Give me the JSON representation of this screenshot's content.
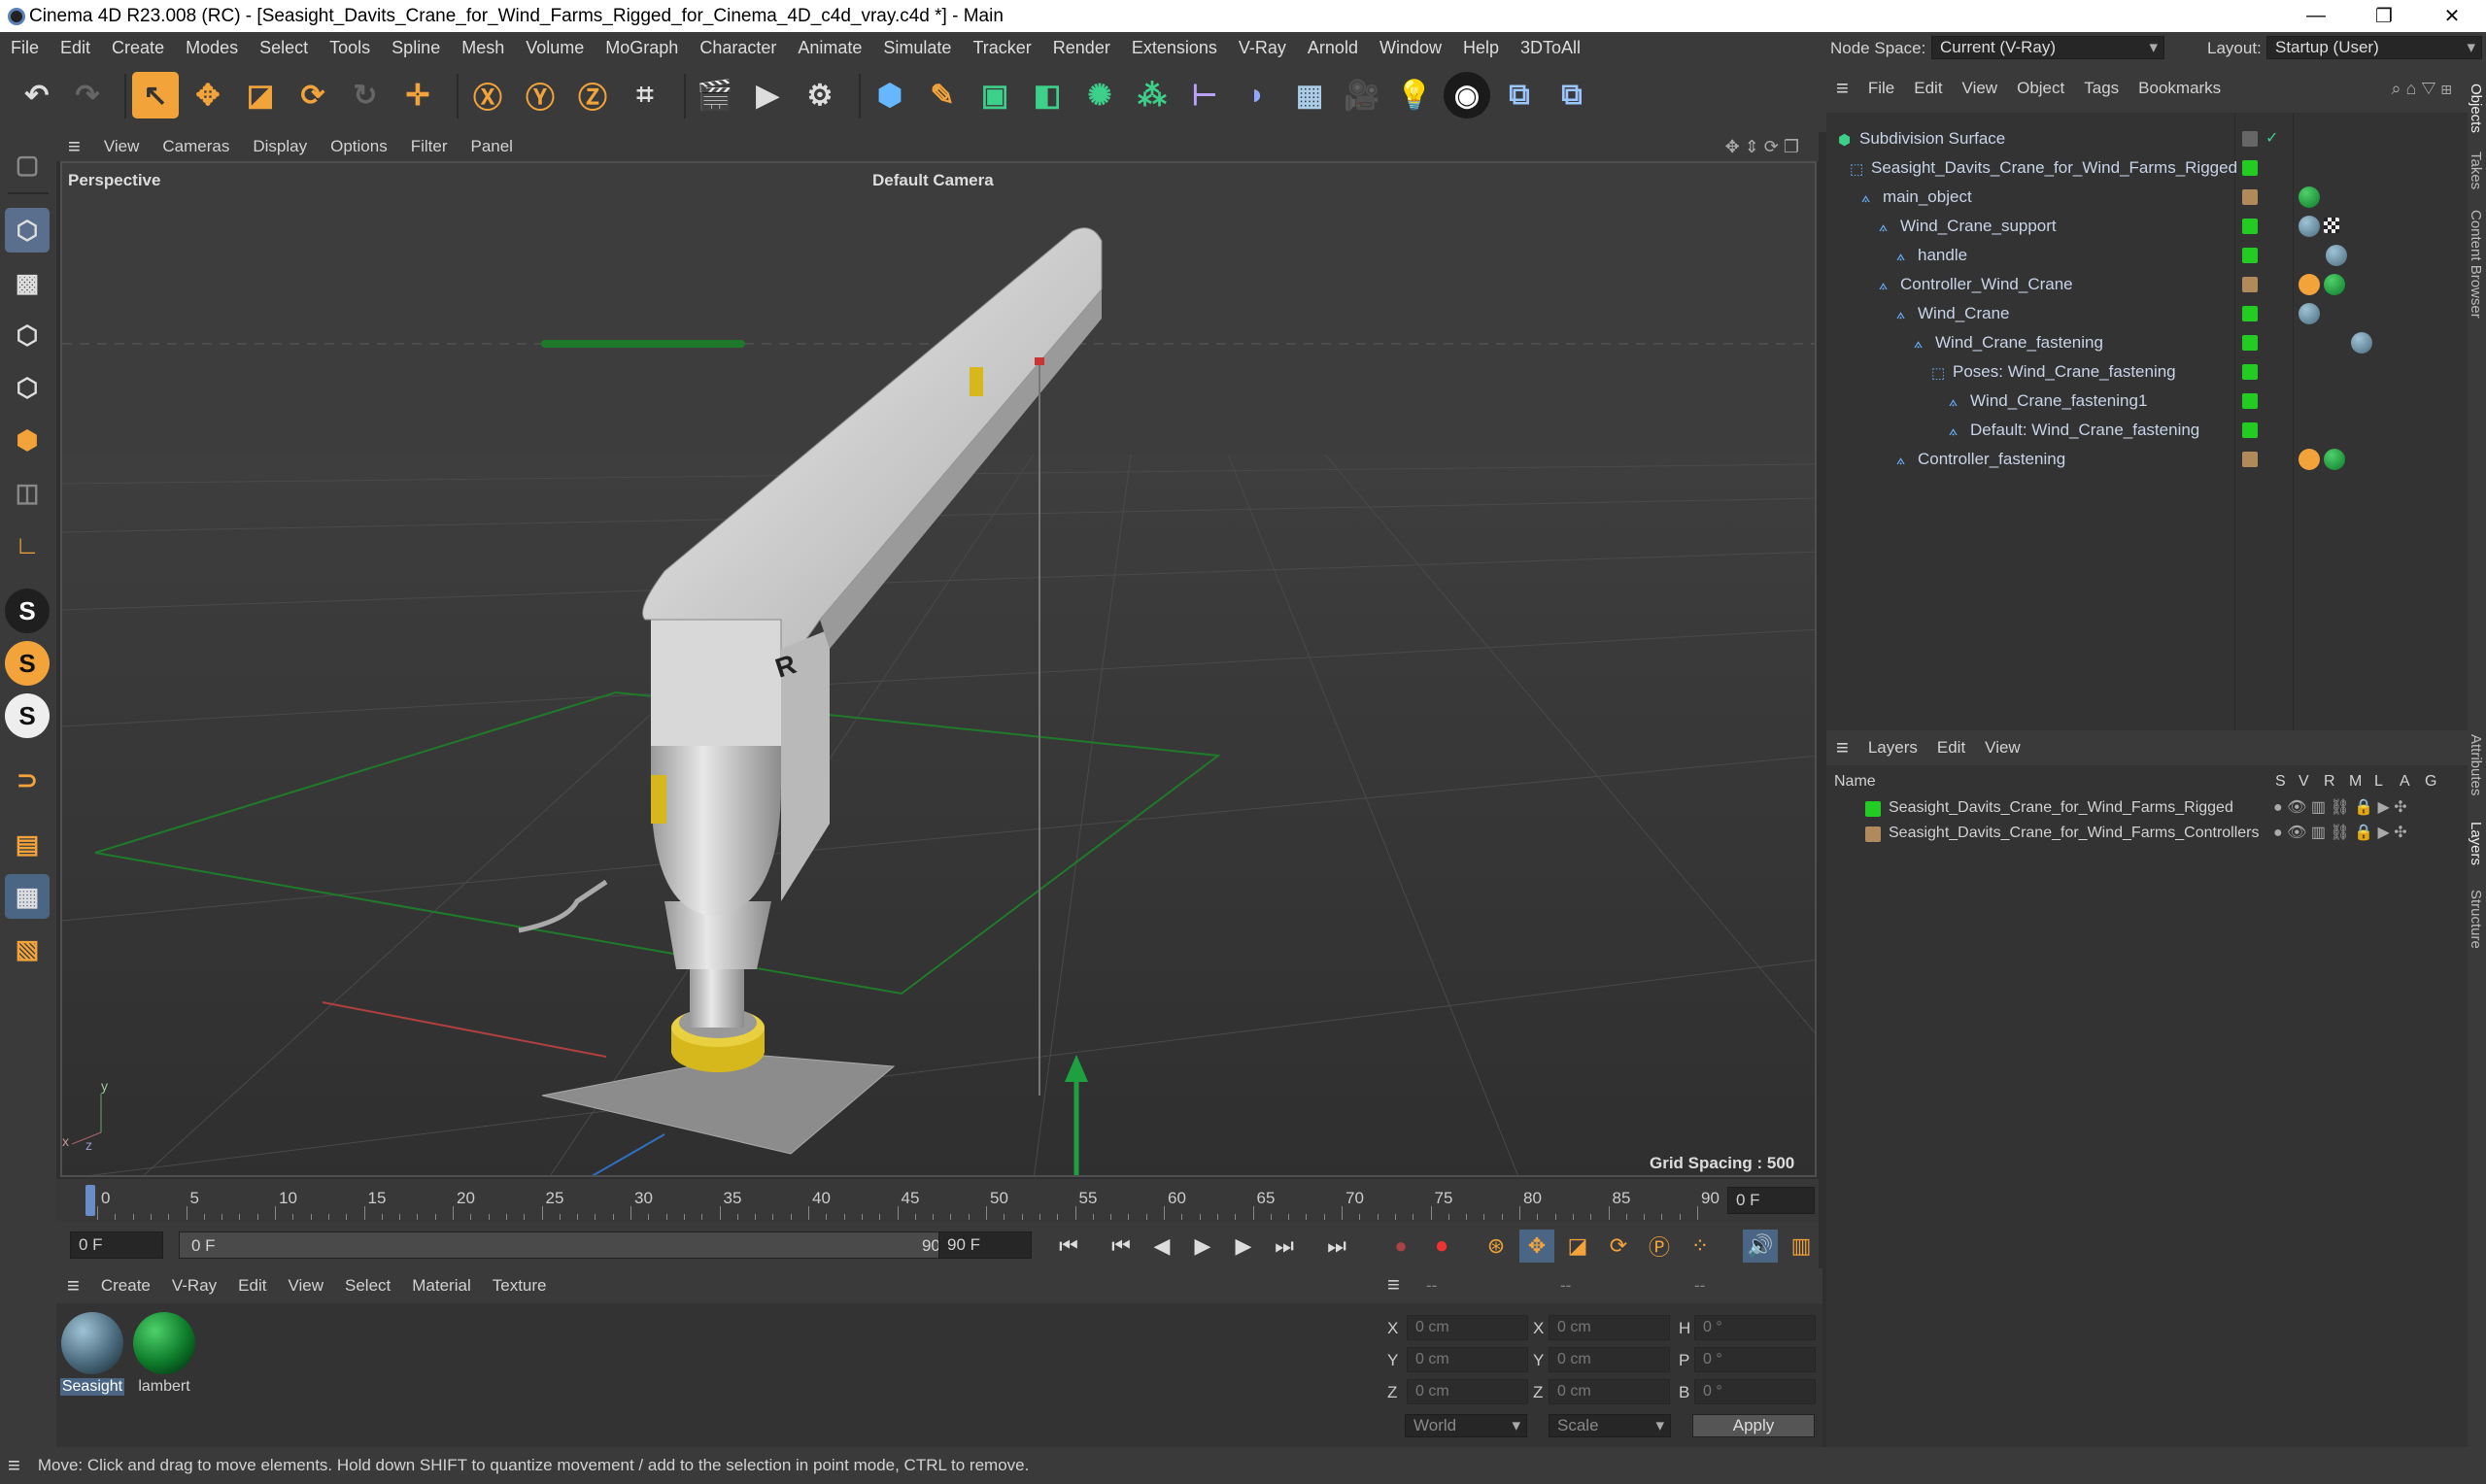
{
  "window": {
    "title": "Cinema 4D R23.008 (RC) - [Seasight_Davits_Crane_for_Wind_Farms_Rigged_for_Cinema_4D_c4d_vray.c4d *] - Main"
  },
  "menu": [
    "File",
    "Edit",
    "Create",
    "Modes",
    "Select",
    "Tools",
    "Spline",
    "Mesh",
    "Volume",
    "MoGraph",
    "Character",
    "Animate",
    "Simulate",
    "Tracker",
    "Render",
    "Extensions",
    "V-Ray",
    "Arnold",
    "Window",
    "Help",
    "3DToAll"
  ],
  "nodespace": {
    "label": "Node Space:",
    "value": "Current (V-Ray)",
    "layout_label": "Layout:",
    "layout_value": "Startup (User)"
  },
  "viewport": {
    "menu": [
      "View",
      "Cameras",
      "Display",
      "Options",
      "Filter",
      "Panel"
    ],
    "projection": "Perspective",
    "camera": "Default Camera",
    "grid_spacing": "Grid Spacing : 500 cm"
  },
  "timeline": {
    "ticks": [
      "0",
      "5",
      "10",
      "15",
      "20",
      "25",
      "30",
      "35",
      "40",
      "45",
      "50",
      "55",
      "60",
      "65",
      "70",
      "75",
      "80",
      "85",
      "90"
    ],
    "current_frame": "0 F",
    "start": "0 F",
    "range_start": "0 F",
    "range_end": "90 F",
    "end": "90 F"
  },
  "materials": {
    "menu": [
      "Create",
      "V-Ray",
      "Edit",
      "View",
      "Select",
      "Material",
      "Texture"
    ],
    "items": [
      {
        "name": "Seasight",
        "color": "#4a6b7d"
      },
      {
        "name": "lambert",
        "color": "#0d7a2a"
      }
    ]
  },
  "coords": {
    "header": [
      "--",
      "--",
      "--"
    ],
    "rows": [
      {
        "a": "X",
        "av": "0 cm",
        "b": "X",
        "bv": "0 cm",
        "c": "H",
        "cv": "0 °"
      },
      {
        "a": "Y",
        "av": "0 cm",
        "b": "Y",
        "bv": "0 cm",
        "c": "P",
        "cv": "0 °"
      },
      {
        "a": "Z",
        "av": "0 cm",
        "b": "Z",
        "bv": "0 cm",
        "c": "B",
        "cv": "0 °"
      }
    ],
    "mode": "World",
    "scale": "Scale",
    "apply": "Apply"
  },
  "objects": {
    "menu": [
      "File",
      "Edit",
      "View",
      "Object",
      "Tags",
      "Bookmarks"
    ],
    "tree": [
      {
        "name": "Subdivision Surface",
        "color": "#888888"
      },
      {
        "name": "Seasight_Davits_Crane_for_Wind_Farms_Rigged",
        "color": "#22cc22"
      },
      {
        "name": "main_object",
        "color": "#b08a5a"
      },
      {
        "name": "Wind_Crane_support",
        "color": "#22cc22"
      },
      {
        "name": "handle",
        "color": "#22cc22"
      },
      {
        "name": "Controller_Wind_Crane",
        "color": "#b08a5a"
      },
      {
        "name": "Wind_Crane",
        "color": "#22cc22"
      },
      {
        "name": "Wind_Crane_fastening",
        "color": "#22cc22"
      },
      {
        "name": "Poses: Wind_Crane_fastening",
        "color": "#22cc22"
      },
      {
        "name": "Wind_Crane_fastening1",
        "color": "#22cc22"
      },
      {
        "name": "Default: Wind_Crane_fastening",
        "color": "#22cc22"
      },
      {
        "name": "Controller_fastening",
        "color": "#b08a5a"
      }
    ]
  },
  "layers": {
    "menu": [
      "Layers",
      "Edit",
      "View"
    ],
    "columns": {
      "name": "Name",
      "flags": [
        "S",
        "V",
        "R",
        "M",
        "L",
        "A",
        "G"
      ]
    },
    "items": [
      {
        "name": "Seasight_Davits_Crane_for_Wind_Farms_Rigged",
        "color": "#22cc22"
      },
      {
        "name": "Seasight_Davits_Crane_for_Wind_Farms_Controllers",
        "color": "#b08a5a"
      }
    ]
  },
  "side_tabs": [
    "Objects",
    "Takes",
    "Content Browser",
    "Attributes",
    "Layers",
    "Structure"
  ],
  "status": "Move: Click and drag to move elements. Hold down SHIFT to quantize movement / add to the selection in point mode, CTRL to remove."
}
